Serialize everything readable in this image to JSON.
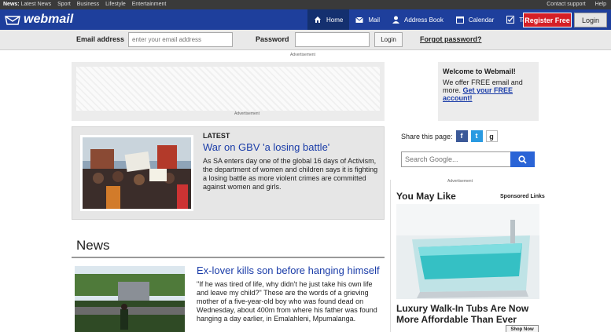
{
  "topbar": {
    "news_prefix": "News:",
    "links": [
      "Latest News",
      "Sport",
      "Business",
      "Lifestyle",
      "Entertainment"
    ],
    "right_links": [
      "Contact support",
      "Help"
    ]
  },
  "header": {
    "logo_text": "webmail",
    "nav": [
      {
        "label": "Home",
        "icon": "home-icon",
        "active": true
      },
      {
        "label": "Mail",
        "icon": "mail-icon",
        "active": false
      },
      {
        "label": "Address Book",
        "icon": "contact-icon",
        "active": false
      },
      {
        "label": "Calendar",
        "icon": "calendar-icon",
        "active": false
      },
      {
        "label": "Tasks",
        "icon": "tasks-icon",
        "active": false
      }
    ],
    "register_label": "Register Free",
    "login_label": "Login"
  },
  "login_bar": {
    "email_label": "Email address",
    "email_placeholder": "enter your email address",
    "password_label": "Password",
    "password_value": "",
    "login_button": "Login",
    "forgot_link": "Forgot password?"
  },
  "ads": {
    "label": "Advertisement"
  },
  "welcome": {
    "title": "Welcome to Webmail!",
    "text": "We offer FREE email and more.",
    "link": "Get your FREE account!"
  },
  "latest": {
    "kicker": "LATEST",
    "headline": "War on GBV 'a losing battle'",
    "summary": "As SA enters day one of the global 16 days of Activism, the department of women and children says it is fighting a losing battle as more violent crimes are committed against women and girls."
  },
  "share": {
    "label": "Share this page:",
    "buttons": [
      "f",
      "t",
      "g"
    ]
  },
  "search": {
    "placeholder": "Search Google..."
  },
  "news": {
    "section_title": "News",
    "headline": "Ex-lover kills son before hanging himself",
    "summary": "\"If he was tired of life, why didn't he just take his own life and leave my child?\" These are the words of a grieving mother of a five-year-old boy who was found dead on Wednesday, about 400m from where his father was found hanging a day earlier, in Emalahleni, Mpumalanga."
  },
  "sponsored": {
    "title": "You May Like",
    "label": "Sponsored Links",
    "headline": "Luxury Walk-In Tubs Are Now More Affordable Than Ever",
    "cta": "Shop Now"
  },
  "colors": {
    "header_blue": "#1e3f9c",
    "link_blue": "#1a3ca8",
    "register_red": "#d51f26",
    "search_blue": "#2a64d6"
  }
}
